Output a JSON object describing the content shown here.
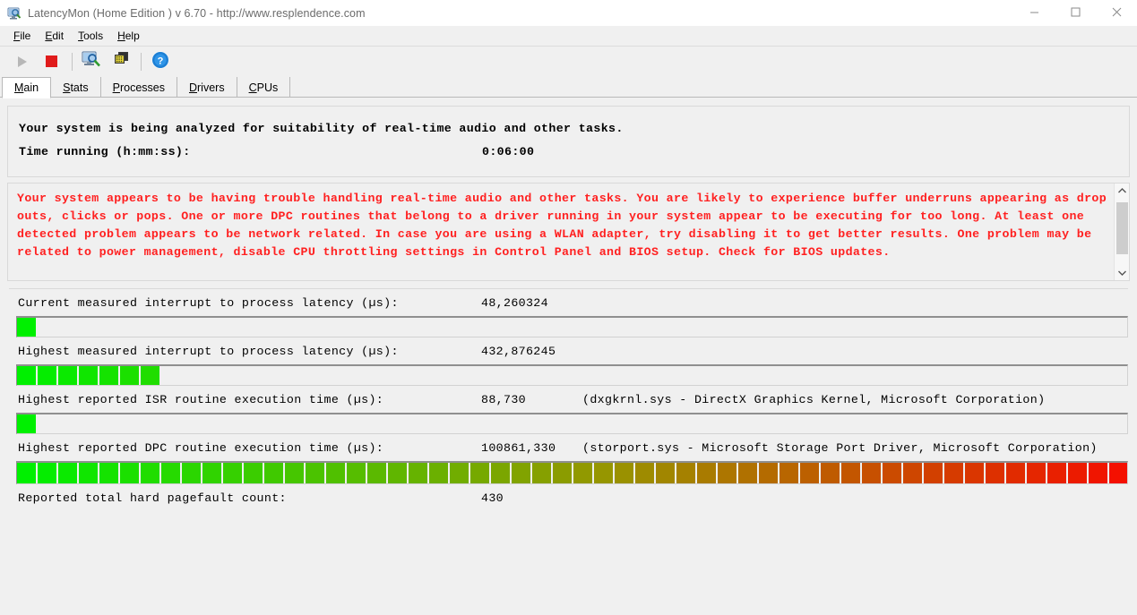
{
  "window": {
    "title": "LatencyMon  (Home Edition )  v 6.70 - http://www.resplendence.com",
    "icon": "latencymon-app-icon",
    "minimize": "—",
    "maximize": "☐",
    "close": "✕"
  },
  "menu": [
    {
      "label": "File",
      "accel": "F"
    },
    {
      "label": "Edit",
      "accel": "E"
    },
    {
      "label": "Tools",
      "accel": "T"
    },
    {
      "label": "Help",
      "accel": "H"
    }
  ],
  "toolbar": {
    "buttons": [
      {
        "name": "play-button",
        "icon": "play-triangle-icon",
        "enabled": false
      },
      {
        "name": "stop-button",
        "icon": "stop-square-icon",
        "enabled": true
      },
      {
        "name": "analyze-button",
        "icon": "monitor-wand-icon",
        "enabled": true
      },
      {
        "name": "report-button",
        "icon": "stacked-windows-icon",
        "enabled": true
      },
      {
        "name": "help-button",
        "icon": "question-help-icon",
        "enabled": true
      }
    ]
  },
  "tabs": [
    {
      "label": "Main",
      "accel": "M",
      "active": true
    },
    {
      "label": "Stats",
      "accel": "S",
      "active": false
    },
    {
      "label": "Processes",
      "accel": "P",
      "active": false
    },
    {
      "label": "Drivers",
      "accel": "D",
      "active": false
    },
    {
      "label": "CPUs",
      "accel": "C",
      "active": false
    }
  ],
  "summary": {
    "headline": "Your system is being analyzed for suitability of real-time audio and other tasks.",
    "time_label": "Time running (h:mm:ss):",
    "time_value": "0:06:00"
  },
  "warning": {
    "color": "#ff2020",
    "text": "Your system appears to be having trouble handling real-time audio and other tasks. You are likely to experience buffer underruns appearing as drop outs, clicks or pops. One or more DPC routines that belong to a driver running in your system appear to be executing for too long. At least one detected problem appears to be network related. In case you are using a WLAN adapter, try disabling it to get better results. One problem may be related to power management, disable CPU throttling settings in Control Panel and BIOS setup. Check for BIOS updates.",
    "scroll_up": "▲",
    "scroll_down": "▼"
  },
  "metrics": [
    {
      "label": "Current measured interrupt to process latency (µs):",
      "value": "48,260324",
      "extra": "",
      "segments": 1
    },
    {
      "label": "Highest measured interrupt to process latency (µs):",
      "value": "432,876245",
      "extra": "",
      "segments": 7
    },
    {
      "label": "Highest reported ISR routine execution time (µs):",
      "value": "88,730",
      "extra": "(dxgkrnl.sys - DirectX Graphics Kernel, Microsoft Corporation)",
      "segments": 1
    },
    {
      "label": "Highest reported DPC routine execution time (µs):",
      "value": "100861,330",
      "extra": "(storport.sys - Microsoft Storage Port Driver, Microsoft Corporation)",
      "segments": 57
    }
  ],
  "pagefault": {
    "label": "Reported total hard pagefault count:",
    "value": "430"
  },
  "colors": {
    "bar_start": "#00f000",
    "bar_mid": "#6f9000",
    "bar_end": "#ff0000",
    "warning_text": "#ff2020",
    "window_bg": "#f0f0f0",
    "title_text": "#6b6b6b"
  }
}
